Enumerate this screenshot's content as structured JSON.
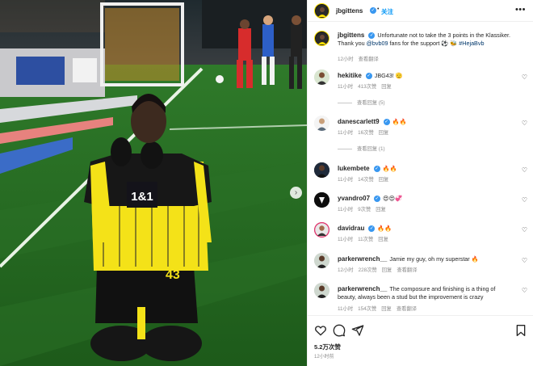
{
  "post": {
    "username": "jbgittens",
    "follow_label": "关注",
    "more_icon": "more-horizontal-icon",
    "caption_text": "Unfortunate not to take the 3 points in the Klassiker. Thank you ",
    "caption_mention": "@bvb09",
    "caption_text2": " fans for the support ⚽️ 🐝 ",
    "caption_hashtag": "#HejaBvb",
    "caption_time": "12小时",
    "caption_translate": "查看翻译",
    "jersey_sponsor": "1&1",
    "jersey_number": "43",
    "likes": "5.2万次赞",
    "post_time": "12小时前"
  },
  "comments": [
    {
      "username": "hekitike",
      "verified": true,
      "text": "JBG43! 🫡",
      "time": "11小时",
      "likes": "413次赞",
      "reply": "回复",
      "view_replies": "查看回复 (5)"
    },
    {
      "username": "danescarlett9",
      "verified": true,
      "text": "🔥🔥",
      "time": "11小时",
      "likes": "16次赞",
      "reply": "回复",
      "view_replies": "查看回复 (1)"
    },
    {
      "username": "lukembete",
      "verified": true,
      "text": "🔥🔥",
      "time": "11小时",
      "likes": "14次赞",
      "reply": "回复"
    },
    {
      "username": "yvandro07",
      "verified": true,
      "text": "😍😍💞",
      "time": "11小时",
      "likes": "9次赞",
      "reply": "回复"
    },
    {
      "username": "davidrau",
      "verified": true,
      "text": "🔥🔥",
      "time": "11小时",
      "likes": "11次赞",
      "reply": "回复"
    },
    {
      "username": "parkerwrench__",
      "verified": false,
      "text": "Jamie my guy, oh my superstar 🔥",
      "time": "12小时",
      "likes": "228次赞",
      "reply": "回复",
      "translate": "查看翻译"
    },
    {
      "username": "parkerwrench__",
      "verified": false,
      "text": "The composure and finishing is a thing of beauty, always been a stud but the improvement is crazy",
      "time": "11小时",
      "likes": "154次赞",
      "reply": "回复",
      "translate": "查看翻译"
    }
  ],
  "icons": {
    "like": "heart-icon",
    "comment": "comment-icon",
    "share": "send-icon",
    "save": "bookmark-icon",
    "next": "chevron-right-icon"
  },
  "colors": {
    "accent": "#0095f6",
    "verified": "#3897f0",
    "bvb_yellow": "#fde100"
  }
}
